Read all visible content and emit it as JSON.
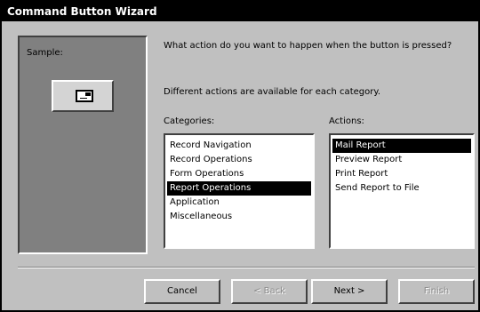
{
  "window": {
    "title": "Command Button Wizard"
  },
  "sample": {
    "label": "Sample:",
    "icon": "mail-envelope-icon"
  },
  "prompt": {
    "question": "What action do you want to happen when the button is pressed?",
    "hint": "Different actions are available for each category."
  },
  "categories": {
    "label": "Categories:",
    "items": [
      {
        "label": "Record Navigation",
        "selected": false
      },
      {
        "label": "Record Operations",
        "selected": false
      },
      {
        "label": "Form Operations",
        "selected": false
      },
      {
        "label": "Report Operations",
        "selected": true
      },
      {
        "label": "Application",
        "selected": false
      },
      {
        "label": "Miscellaneous",
        "selected": false
      }
    ]
  },
  "actions": {
    "label": "Actions:",
    "items": [
      {
        "label": "Mail Report",
        "selected": true
      },
      {
        "label": "Preview Report",
        "selected": false
      },
      {
        "label": "Print Report",
        "selected": false
      },
      {
        "label": "Send Report to File",
        "selected": false
      }
    ]
  },
  "buttons": {
    "cancel": "Cancel",
    "back": "< Back",
    "next": "Next >",
    "finish": "Finish"
  }
}
